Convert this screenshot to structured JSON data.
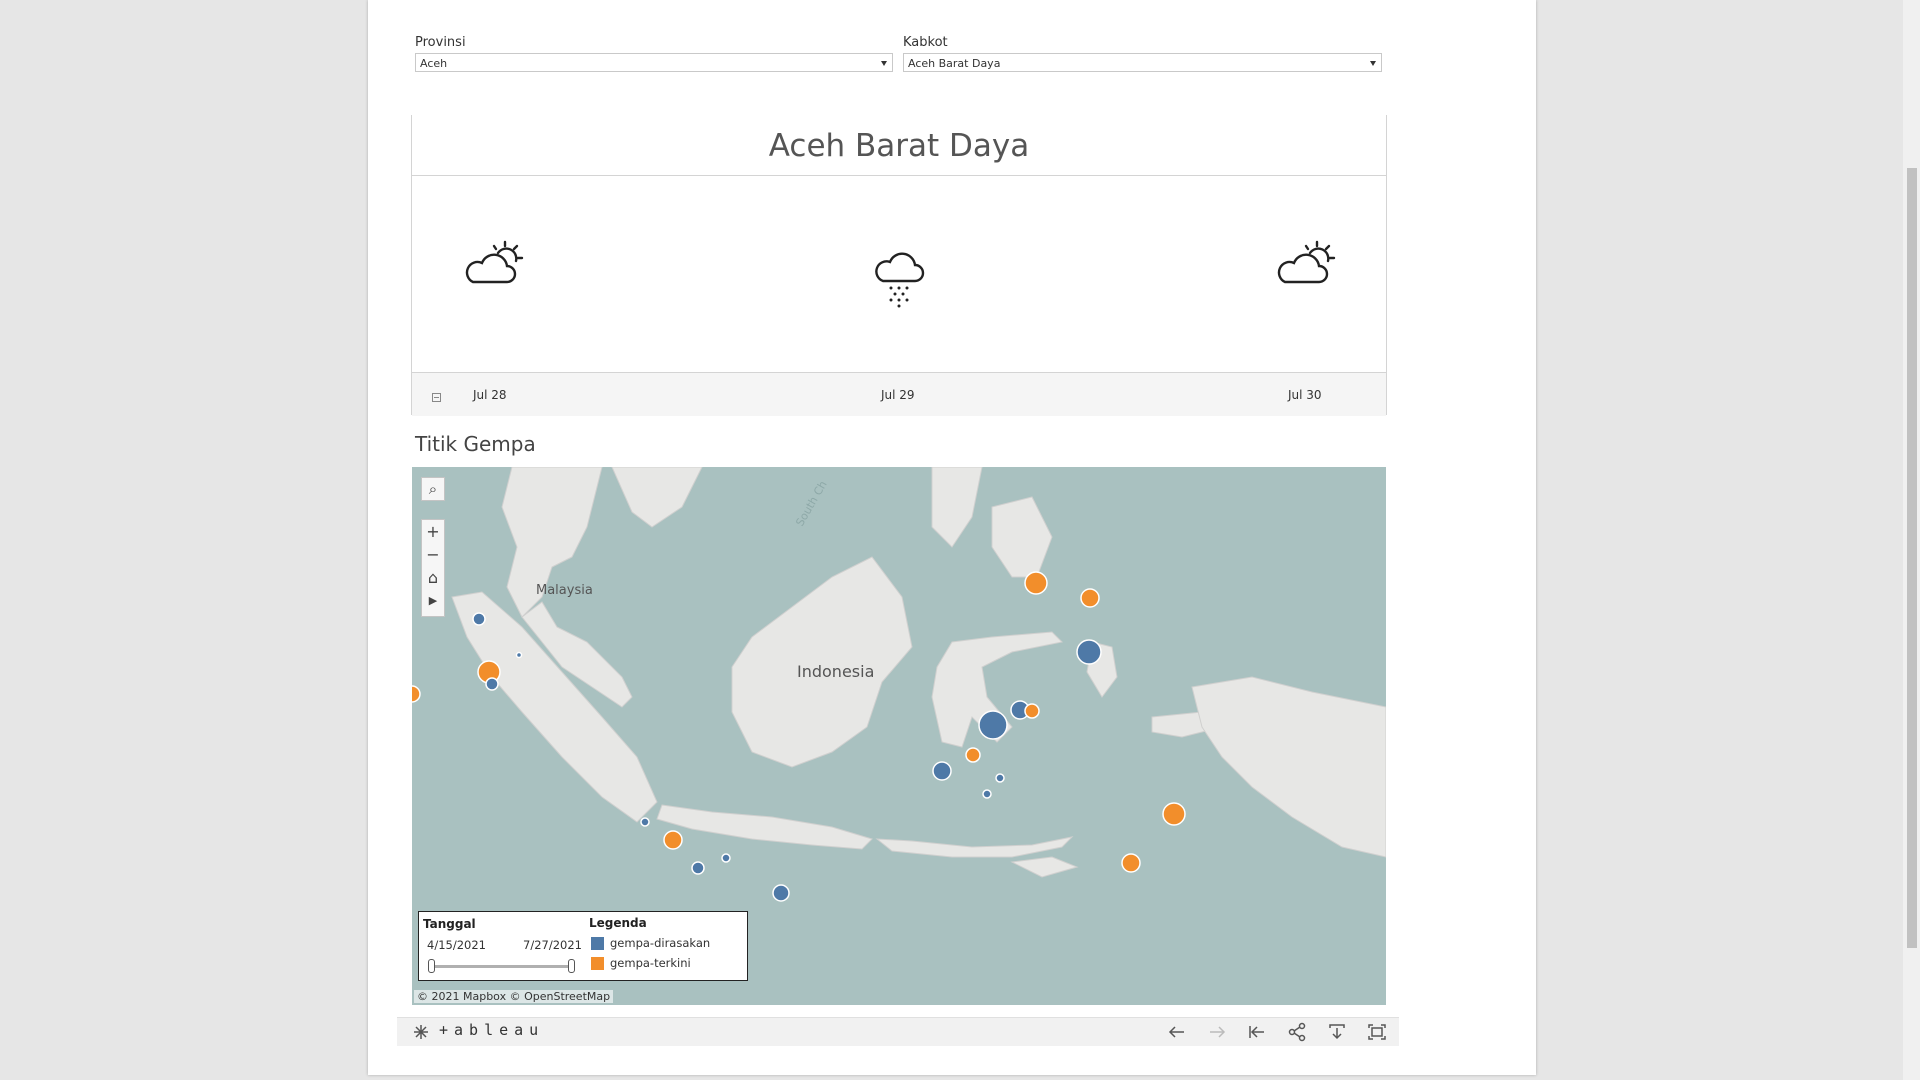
{
  "filters": {
    "provinsi": {
      "label": "Provinsi",
      "value": "Aceh"
    },
    "kabkot": {
      "label": "Kabkot",
      "value": "Aceh Barat Daya"
    }
  },
  "weather": {
    "title": "Aceh Barat Daya",
    "days": [
      {
        "date": "Jul 28",
        "icon": "partly-cloudy-icon"
      },
      {
        "date": "Jul 29",
        "icon": "cloud-snow-icon"
      },
      {
        "date": "Jul 30",
        "icon": "partly-cloudy-icon"
      }
    ]
  },
  "map": {
    "title": "Titik Gempa",
    "labels": {
      "malaysia": "Malaysia",
      "indonesia": "Indonesia",
      "sea": "South Ch"
    },
    "credit": "© 2021 Mapbox  © OpenStreetMap",
    "legend": {
      "date_header": "Tanggal",
      "start_date": "4/15/2021",
      "end_date": "7/27/2021",
      "legend_header": "Legenda",
      "items": [
        {
          "label": "gempa-dirasakan",
          "color": "#4e79a7"
        },
        {
          "label": "gempa-terkini",
          "color": "#f28e2b"
        }
      ]
    },
    "colors": {
      "water": "#a9c1c0",
      "land": "#e7e7e5"
    }
  },
  "footer": {
    "brand": "+ableau"
  }
}
